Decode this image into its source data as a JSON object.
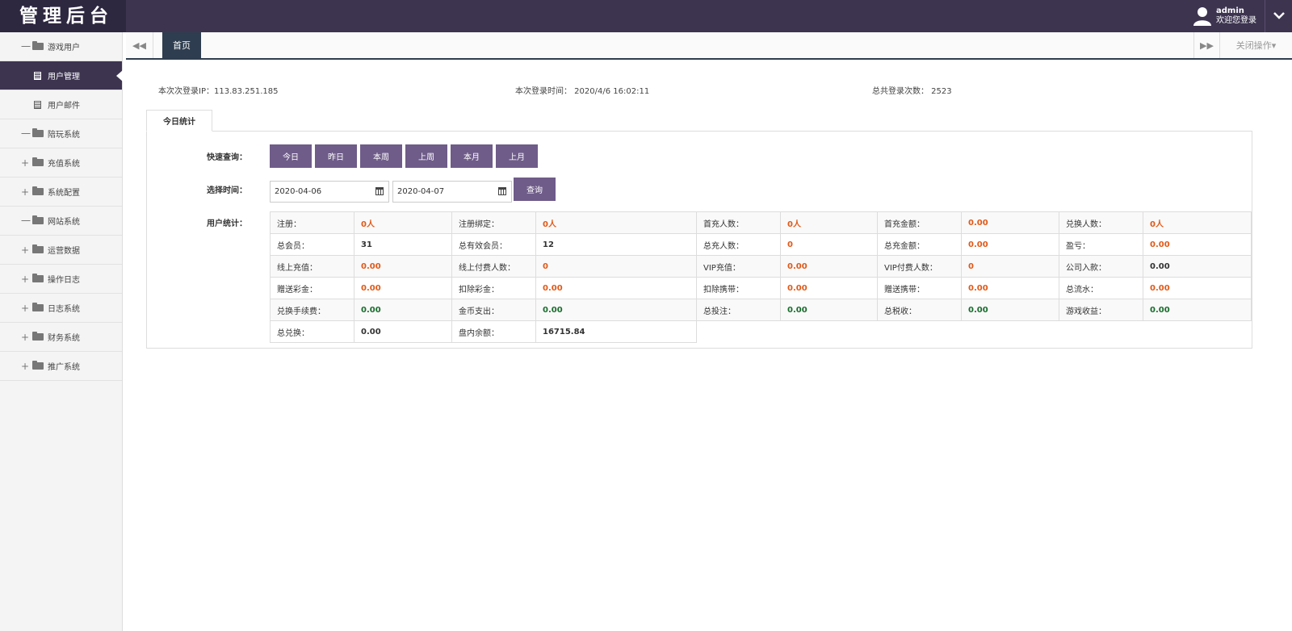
{
  "app": {
    "title": "管理后台"
  },
  "header": {
    "username": "admin",
    "welcome": "欢迎您登录"
  },
  "sidebar": {
    "items": [
      {
        "label": "游戏用户",
        "toggle": "一",
        "type": "group"
      },
      {
        "label": "用户管理",
        "type": "sub",
        "active": true
      },
      {
        "label": "用户邮件",
        "type": "sub"
      },
      {
        "label": "陪玩系统",
        "toggle": "一",
        "type": "group"
      },
      {
        "label": "充值系统",
        "toggle": "+",
        "type": "group"
      },
      {
        "label": "系统配置",
        "toggle": "+",
        "type": "group"
      },
      {
        "label": "网站系统",
        "toggle": "一",
        "type": "group"
      },
      {
        "label": "运营数据",
        "toggle": "+",
        "type": "group"
      },
      {
        "label": "操作日志",
        "toggle": "+",
        "type": "group"
      },
      {
        "label": "日志系统",
        "toggle": "+",
        "type": "group"
      },
      {
        "label": "财务系统",
        "toggle": "+",
        "type": "group"
      },
      {
        "label": "推广系统",
        "toggle": "+",
        "type": "group"
      }
    ]
  },
  "tabbar": {
    "home_tab": "首页",
    "close_ops": "关闭操作▾"
  },
  "info": {
    "login_ip": "本次次登录IP：113.83.251.185",
    "login_time": "本次登录时间： 2020/4/6 16:02:11",
    "login_count": "总共登录次数： 2523"
  },
  "panel": {
    "tab_label": "今日统计",
    "quick_label": "快速查询：",
    "quick_buttons": [
      "今日",
      "昨日",
      "本周",
      "上周",
      "本月",
      "上月"
    ],
    "time_label": "选择时间：",
    "date_from": "2020-04-06",
    "date_to": "2020-04-07",
    "search_button": "查询",
    "stats_label": "用户统计："
  },
  "stats": {
    "rows": [
      [
        {
          "label": "注册：",
          "value": "0人",
          "color": "red"
        },
        {
          "label": "注册绑定：",
          "value": "0人",
          "color": "red"
        },
        {
          "label": "首充人数：",
          "value": "0人",
          "color": "red"
        },
        {
          "label": "首充金额：",
          "value": "0.00",
          "color": "red"
        },
        {
          "label": "兑换人数：",
          "value": "0人",
          "color": "red"
        }
      ],
      [
        {
          "label": "总会员：",
          "value": "31",
          "color": "dark"
        },
        {
          "label": "总有效会员：",
          "value": "12",
          "color": "dark"
        },
        {
          "label": "总充人数：",
          "value": "0",
          "color": "red"
        },
        {
          "label": "总充金额：",
          "value": "0.00",
          "color": "red"
        },
        {
          "label": "盈亏：",
          "value": "0.00",
          "color": "red"
        }
      ],
      [
        {
          "label": "线上充值：",
          "value": "0.00",
          "color": "red"
        },
        {
          "label": "线上付费人数：",
          "value": "0",
          "color": "red"
        },
        {
          "label": "VIP充值：",
          "value": "0.00",
          "color": "red"
        },
        {
          "label": "VIP付费人数：",
          "value": "0",
          "color": "red"
        },
        {
          "label": "公司入款：",
          "value": "0.00",
          "color": "dark"
        }
      ],
      [
        {
          "label": "赠送彩金：",
          "value": "0.00",
          "color": "red"
        },
        {
          "label": "扣除彩金：",
          "value": "0.00",
          "color": "red"
        },
        {
          "label": "扣除携带：",
          "value": "0.00",
          "color": "red"
        },
        {
          "label": "赠送携带：",
          "value": "0.00",
          "color": "red"
        },
        {
          "label": "总流水：",
          "value": "0.00",
          "color": "red"
        }
      ],
      [
        {
          "label": "兑换手续费：",
          "value": "0.00",
          "color": "green"
        },
        {
          "label": "金币支出：",
          "value": "0.00",
          "color": "green"
        },
        {
          "label": "总投注：",
          "value": "0.00",
          "color": "green"
        },
        {
          "label": "总税收：",
          "value": "0.00",
          "color": "green"
        },
        {
          "label": "游戏收益：",
          "value": "0.00",
          "color": "green"
        }
      ],
      [
        {
          "label": "总兑换：",
          "value": "0.00",
          "color": "dark"
        },
        {
          "label": "盘内余额：",
          "value": "16715.84",
          "color": "dark"
        }
      ]
    ]
  },
  "colors": {
    "topbar": "#3d3450",
    "button": "#6f5c89",
    "red": "#e05a1a",
    "green": "#1a6d2e",
    "tab_active": "#2e3d4f"
  }
}
